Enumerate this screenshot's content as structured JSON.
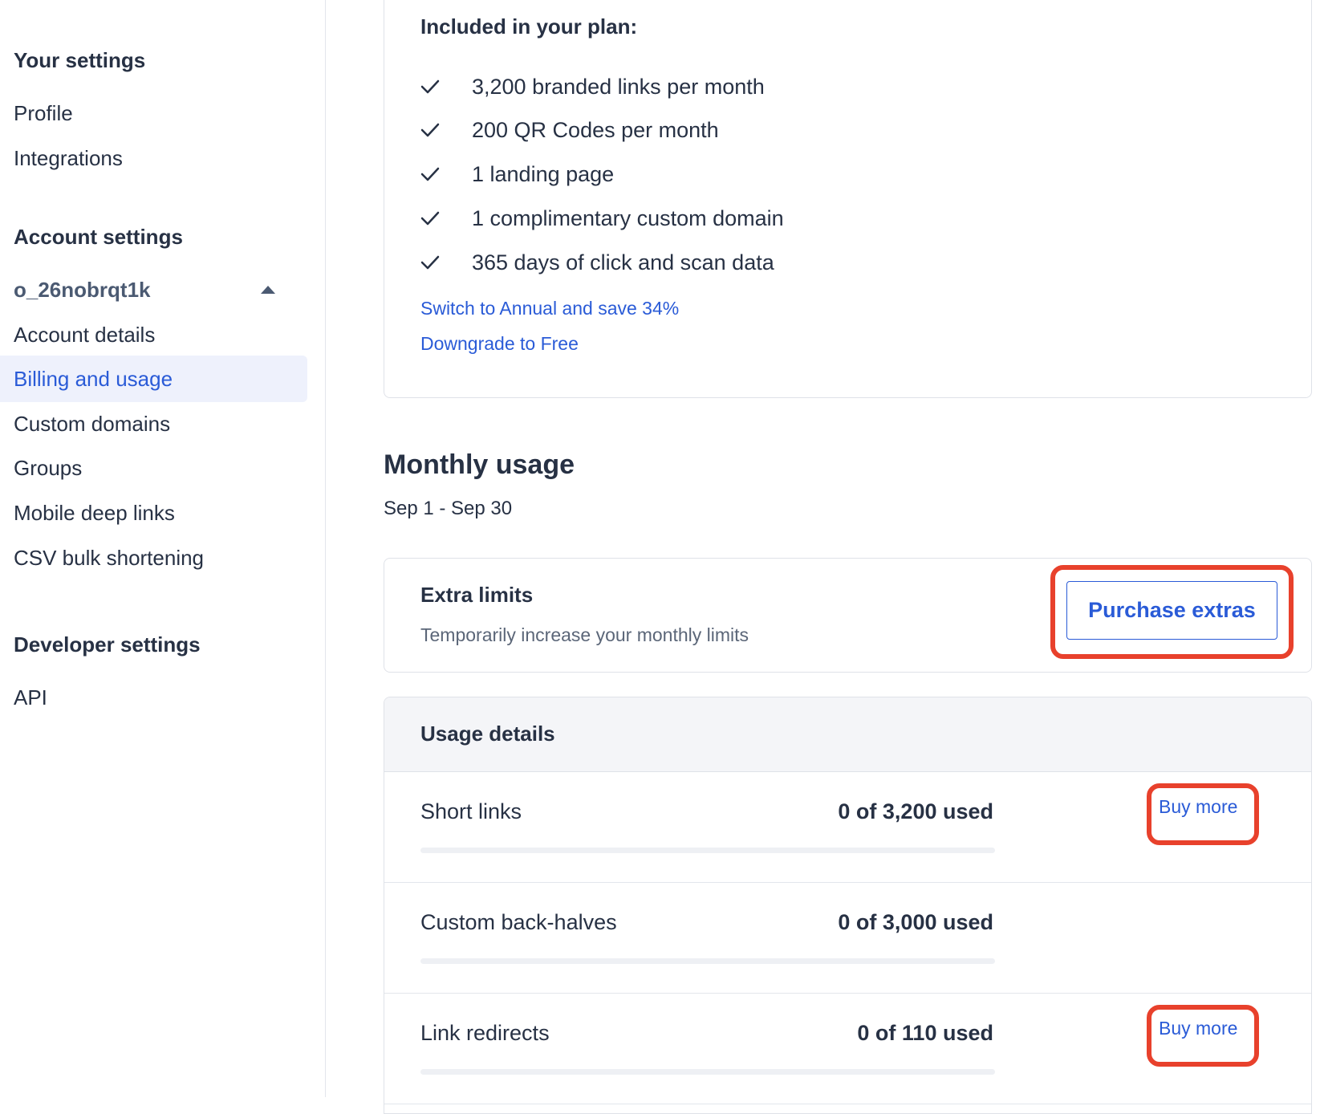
{
  "sidebar": {
    "your_settings_heading": "Your settings",
    "your_settings_items": [
      {
        "label": "Profile"
      },
      {
        "label": "Integrations"
      }
    ],
    "account_settings_heading": "Account settings",
    "org_name": "o_26nobrqt1k",
    "account_items": [
      {
        "label": "Account details"
      },
      {
        "label": "Billing and usage",
        "active": true
      },
      {
        "label": "Custom domains"
      },
      {
        "label": "Groups"
      },
      {
        "label": "Mobile deep links"
      },
      {
        "label": "CSV bulk shortening"
      }
    ],
    "developer_settings_heading": "Developer settings",
    "developer_items": [
      {
        "label": "API"
      }
    ]
  },
  "plan": {
    "included_title": "Included in your plan:",
    "features": [
      "3,200 branded links per month",
      "200 QR Codes per month",
      "1 landing page",
      "1 complimentary custom domain",
      "365 days of click and scan data"
    ],
    "switch_annual_link": "Switch to Annual and save 34%",
    "downgrade_link": "Downgrade to Free"
  },
  "monthly_usage": {
    "title": "Monthly usage",
    "period": "Sep 1 - Sep 30"
  },
  "extras": {
    "title": "Extra limits",
    "subtitle": "Temporarily increase your monthly limits",
    "purchase_button": "Purchase extras"
  },
  "usage_details": {
    "title": "Usage details",
    "rows": [
      {
        "label": "Short links",
        "value": "0 of 3,200 used",
        "used": 0,
        "limit": 3200,
        "buy_more": "Buy more"
      },
      {
        "label": "Custom back-halves",
        "value": "0 of 3,000 used",
        "used": 0,
        "limit": 3000,
        "buy_more": ""
      },
      {
        "label": "Link redirects",
        "value": "0 of 110 used",
        "used": 0,
        "limit": 110,
        "buy_more": "Buy more"
      }
    ]
  },
  "colors": {
    "accent": "#2a5bd7",
    "highlight": "#e8412c",
    "text": "#273144"
  }
}
